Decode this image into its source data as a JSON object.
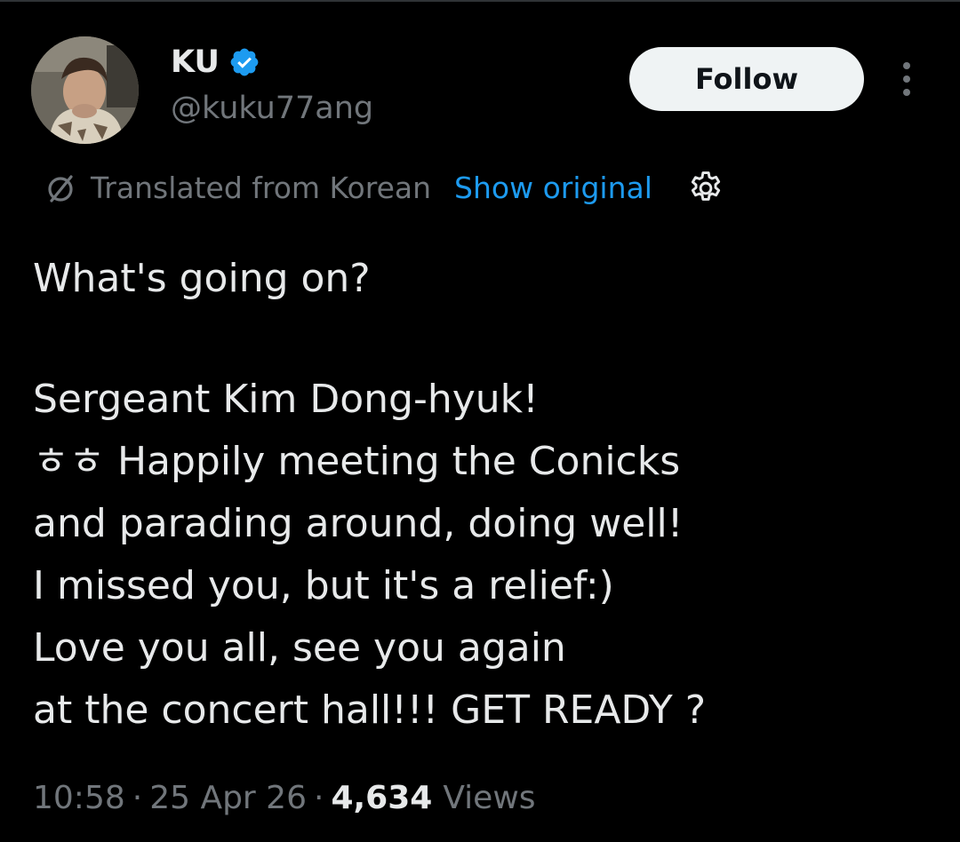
{
  "tweet": {
    "author": {
      "display_name": "KU",
      "handle": "@kuku77ang",
      "verified": true
    },
    "follow_label": "Follow",
    "translation": {
      "notice": "Translated from Korean",
      "show_original": "Show original"
    },
    "text_lines": {
      "l1": "What's going on?",
      "l2": "Sergeant Kim Dong-hyuk!",
      "l3": "ㅎㅎ Happily meeting the Conicks",
      "l4": "and parading around, doing well!",
      "l5": "I missed you, but it's a relief:)",
      "l6": "Love you all, see you again",
      "l7": "at the concert hall!!! GET READY ?"
    },
    "meta": {
      "time": "10:58",
      "separator": "·",
      "date": "25 Apr 26",
      "views_count": "4,634",
      "views_label": "Views"
    }
  },
  "icons": {
    "verified": "verified-badge-icon",
    "translate": "translate-icon",
    "settings": "gear-icon",
    "more": "more-dots-icon"
  },
  "colors": {
    "background": "#000000",
    "text_primary": "#e7e9ea",
    "text_secondary": "#71767b",
    "accent_blue": "#1d9bf0",
    "follow_bg": "#eff3f4"
  }
}
